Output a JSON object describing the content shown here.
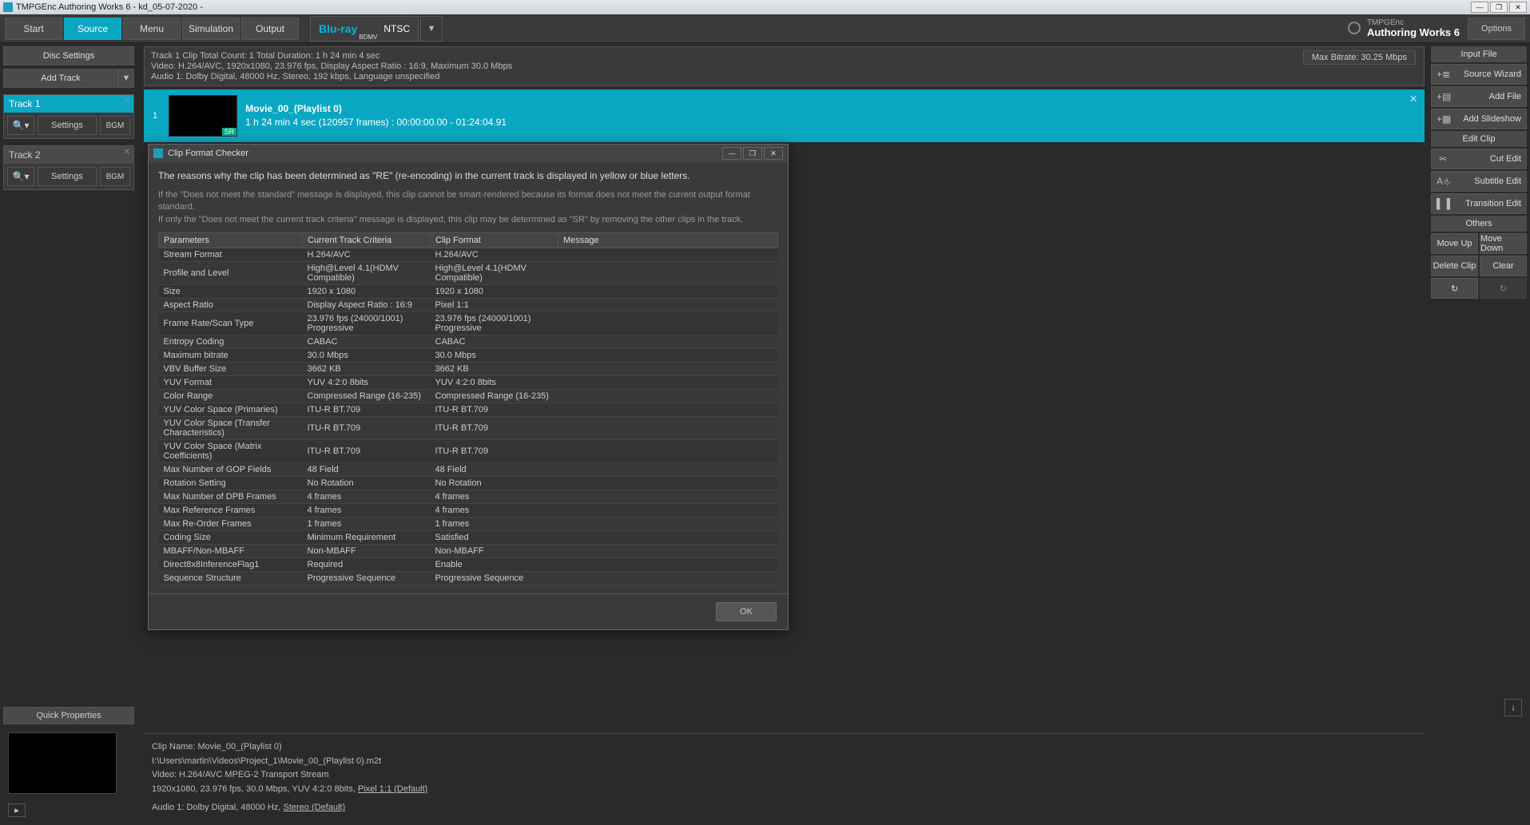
{
  "window": {
    "title": "TMPGEnc Authoring Works 6 - kd_05-07-2020 -",
    "min": "—",
    "max": "❐",
    "close": "✕"
  },
  "nav": {
    "start": "Start",
    "source": "Source",
    "menu": "Menu",
    "simulation": "Simulation",
    "output": "Output"
  },
  "format": {
    "brand": "Blu-ray",
    "sub": "BDMV",
    "region": "NTSC",
    "dd": "▼"
  },
  "brand": {
    "small": "TMPGEnc",
    "big": "Authoring Works 6"
  },
  "options": "Options",
  "leftPanel": {
    "discSettings": "Disc Settings",
    "addTrack": "Add Track",
    "dd": "▼",
    "tracks": [
      {
        "name": "Track 1",
        "zoom": "🔍▾",
        "settings": "Settings",
        "bgm": "BGM",
        "active": true
      },
      {
        "name": "Track 2",
        "zoom": "🔍▾",
        "settings": "Settings",
        "bgm": "BGM",
        "active": false
      }
    ],
    "quickProps": "Quick Properties",
    "play": "▸"
  },
  "summary": {
    "line1": "Track 1   Clip Total Count:  1     Total Duration:  1 h 24 min 4 sec",
    "line2": "Video:       H.264/AVC,  1920x1080,  23.976 fps,  Display Aspect Ratio : 16:9,  Maximum 30.0 Mbps",
    "line3": "Audio 1:    Dolby Digital,  48000  Hz,  Stereo,  192 kbps,  Language unspecified",
    "maxBitrate": "Max Bitrate: 30.25 Mbps"
  },
  "clip": {
    "idx": "1",
    "sr": "SR",
    "title": "Movie_00_(Playlist 0)",
    "sub": "1 h 24 min 4 sec (120957 frames) : 00:00:00.00 - 01:24:04.91",
    "close": "✕"
  },
  "quickInfo": {
    "l1": "Clip Name:  Movie_00_(Playlist 0)",
    "l2": "I:\\Users\\martin\\Videos\\Project_1\\Movie_00_(Playlist 0).m2t",
    "l3": "Video:  H.264/AVC  MPEG-2 Transport Stream",
    "l4a": "            1920x1080,  23.976 fps,  30.0 Mbps,  YUV 4:2:0 8bits,  ",
    "l4u": "Pixel 1:1 (Default)",
    "l5a": "Audio 1:  Dolby Digital, 48000  Hz,  ",
    "l5u": "Stereo (Default)"
  },
  "right": {
    "inputFile": "Input File",
    "sourceWizard": "Source Wizard",
    "addFile": "Add File",
    "addSlideshow": "Add Slideshow",
    "editClip": "Edit Clip",
    "cutEdit": "Cut Edit",
    "subtitleEdit": "Subtitle Edit",
    "transitionEdit": "Transition Edit",
    "others": "Others",
    "moveUp": "Move Up",
    "moveDown": "Move Down",
    "deleteClip": "Delete Clip",
    "clear": "Clear",
    "refresh": "↻",
    "refresh2": "↻"
  },
  "dialog": {
    "title": "Clip Format Checker",
    "msg": "The reasons why the clip has been determined as \"RE\" (re-encoding) in the current track is displayed in yellow or blue letters.",
    "note1": "If the \"Does not meet the standard\" message is displayed, this clip cannot be smart-rendered because its format does not meet the current output format standard.",
    "note2": "If only the \"Does not meet the current track criteria\" message is displayed, this clip may be determined as \"SR\" by removing the other clips in the track.",
    "hParam": "Parameters",
    "hCriteria": "Current Track Criteria",
    "hClip": "Clip Format",
    "hMsg": "Message",
    "rows": [
      [
        "Stream Format",
        "H.264/AVC",
        "H.264/AVC",
        ""
      ],
      [
        "Profile and Level",
        "High@Level 4.1(HDMV Compatible)",
        "High@Level 4.1(HDMV Compatible)",
        ""
      ],
      [
        "Size",
        "1920 x 1080",
        "1920 x 1080",
        ""
      ],
      [
        "Aspect Ratio",
        "Display Aspect Ratio : 16:9",
        "Pixel 1:1",
        ""
      ],
      [
        "Frame Rate/Scan Type",
        "23.976 fps (24000/1001) Progressive",
        "23.976 fps (24000/1001) Progressive",
        ""
      ],
      [
        "Entropy Coding",
        "CABAC",
        "CABAC",
        ""
      ],
      [
        "Maximum bitrate",
        "30.0 Mbps",
        "30.0 Mbps",
        ""
      ],
      [
        "VBV Buffer Size",
        "3662 KB",
        "3662 KB",
        ""
      ],
      [
        "YUV Format",
        "YUV 4:2:0 8bits",
        "YUV 4:2:0 8bits",
        ""
      ],
      [
        "Color Range",
        "Compressed Range (16-235)",
        "Compressed Range (16-235)",
        ""
      ],
      [
        "YUV Color Space (Primaries)",
        "ITU-R BT.709",
        "ITU-R BT.709",
        ""
      ],
      [
        "YUV Color Space (Transfer Characteristics)",
        "ITU-R BT.709",
        "ITU-R BT.709",
        ""
      ],
      [
        "YUV Color Space (Matrix Coefficients)",
        "ITU-R BT.709",
        "ITU-R BT.709",
        ""
      ],
      [
        "Max Number of GOP Fields",
        "48 Field",
        "48 Field",
        ""
      ],
      [
        "Rotation Setting",
        "No Rotation",
        "No Rotation",
        ""
      ],
      [
        "Max Number of DPB Frames",
        "4  frames",
        "4  frames",
        ""
      ],
      [
        "Max Reference Frames",
        "4  frames",
        "4  frames",
        ""
      ],
      [
        "Max Re-Order Frames",
        "1  frames",
        "1  frames",
        ""
      ],
      [
        "Coding Size",
        "Minimum Requirement",
        "Satisfied",
        ""
      ],
      [
        "MBAFF/Non-MBAFF",
        "Non-MBAFF",
        "Non-MBAFF",
        ""
      ],
      [
        "Direct8x8InferenceFlag1",
        "Required",
        "Enable",
        ""
      ],
      [
        "Sequence Structure",
        "Progressive Sequence",
        "Progressive Sequence",
        ""
      ]
    ],
    "ok": "OK",
    "min": "—",
    "max": "❐",
    "close": "✕"
  },
  "downarrow": "↓"
}
